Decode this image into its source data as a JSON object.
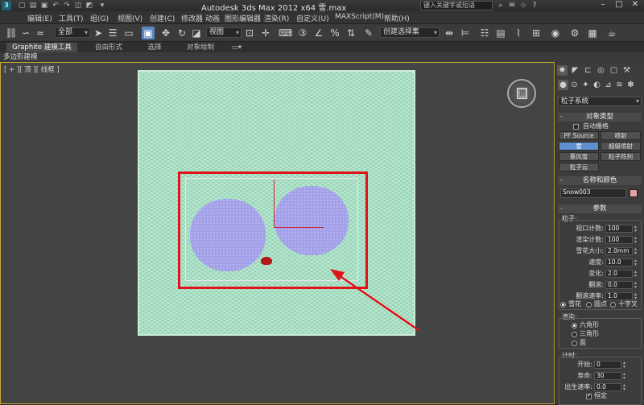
{
  "titlebar": {
    "title": "Autodesk 3ds Max  2012 x64     雪.max",
    "search_placeholder": "键入关键字或短语",
    "logo_letter": "3",
    "quick_access_icons": [
      "new-icon",
      "open-icon",
      "save-icon",
      "undo-icon",
      "redo-icon",
      "hold-icon",
      "fetch-icon",
      "project-icon"
    ],
    "window_buttons": [
      "minimize",
      "maximize",
      "close"
    ]
  },
  "menubar": {
    "items": [
      "编辑(E)",
      "工具(T)",
      "组(G)",
      "视图(V)",
      "创建(C)",
      "修改器",
      "动画",
      "图形编辑器",
      "渲染(R)",
      "自定义(U)",
      "MAXScript(M)",
      "帮助(H)"
    ]
  },
  "toolbar": {
    "selection_filter": "全部",
    "coord_system": "视图",
    "named_selection_placeholder": "创建选择集"
  },
  "ribbon": {
    "tabs": [
      "Graphite 建模工具",
      "自由形式",
      "选择",
      "对象绘制"
    ],
    "selected_tab": "Graphite 建模工具",
    "sub_label": "多边形建模"
  },
  "viewport": {
    "label": "[ + ][ 顶 ][ 线框 ]",
    "viewcube_face": "顶",
    "colors": {
      "background": "#444444",
      "border_active": "#c8a834",
      "snow_plane": "#a8e0c4",
      "particle_blob": "#a3a0ea",
      "highlight_rect": "#e0131b",
      "arrow": "#e0131b"
    }
  },
  "command_panel": {
    "tabs_icons": [
      "create-icon",
      "modify-icon",
      "hierarchy-icon",
      "motion-icon",
      "display-icon",
      "utilities-icon"
    ],
    "category_icons": [
      "geometry-icon",
      "shapes-icon",
      "lights-icon",
      "cameras-icon",
      "helpers-icon",
      "spacewarps-icon",
      "systems-icon"
    ],
    "category_dropdown": "粒子系统",
    "object_type": {
      "header": "对象类型",
      "autogrid_label": "自动栅格",
      "buttons": [
        "PF Source",
        "喷射",
        "雪",
        "超级喷射",
        "暴风雪",
        "粒子阵列",
        "粒子云"
      ],
      "selected": "雪"
    },
    "name_color": {
      "header": "名称和颜色",
      "name_value": "Snow003",
      "color": "#e8a0a0"
    },
    "parameters": {
      "header": "参数",
      "particles_group": "粒子:",
      "fields": [
        {
          "label": "视口计数:",
          "value": "100"
        },
        {
          "label": "渲染计数:",
          "value": "100"
        },
        {
          "label": "雪花大小:",
          "value": "2.0mm"
        },
        {
          "label": "速度:",
          "value": "10.0"
        },
        {
          "label": "变化:",
          "value": "2.0"
        },
        {
          "label": "翻滚:",
          "value": "0.0"
        },
        {
          "label": "翻滚速率:",
          "value": "1.0"
        }
      ],
      "display_options": [
        "雪花",
        "圆点",
        "十字叉"
      ],
      "display_selected": "雪花",
      "render_group": "渲染:",
      "render_options": [
        "六角形",
        "三角形",
        "面"
      ],
      "render_selected": "六角形",
      "timing_group": "计时:",
      "timing_fields": [
        {
          "label": "开始:",
          "value": "0"
        },
        {
          "label": "寿命:",
          "value": "30"
        },
        {
          "label": "出生速率:",
          "value": "0.0"
        }
      ],
      "constant_label": "恒定"
    }
  }
}
